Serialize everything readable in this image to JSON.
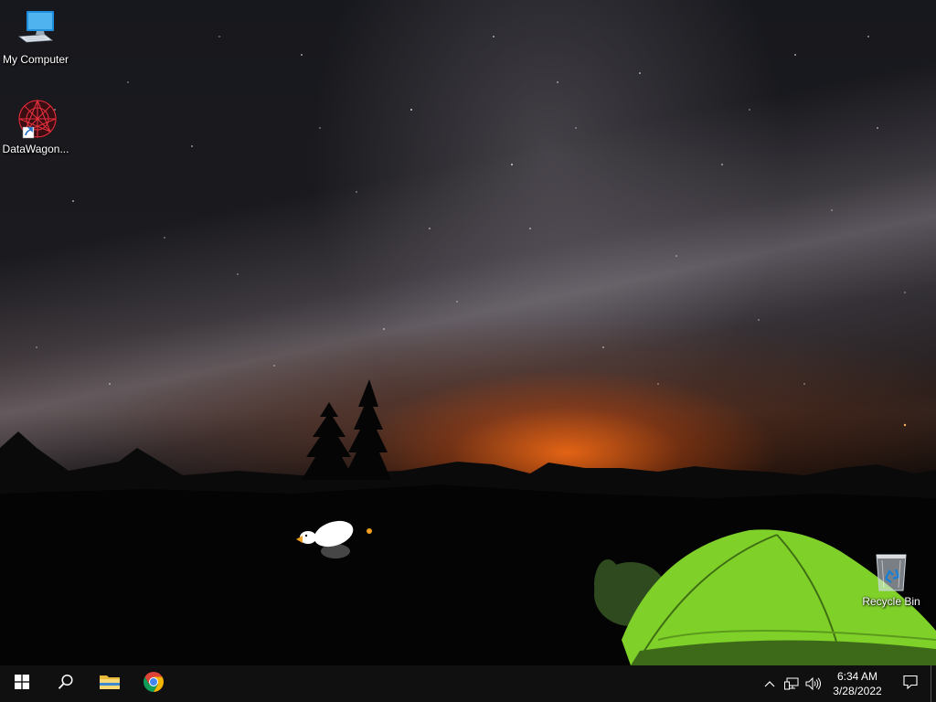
{
  "desktop": {
    "icons": [
      {
        "label": "My Computer",
        "icon": "computer-icon"
      },
      {
        "label": "DataWagon...",
        "icon": "datawagon-icon"
      },
      {
        "label": "Recycle Bin",
        "icon": "recycle-bin-icon"
      }
    ]
  },
  "taskbar": {
    "start": {
      "icon": "windows-logo-icon"
    },
    "search": {
      "icon": "search-icon"
    },
    "pinned": [
      {
        "name": "File Explorer",
        "icon": "folder-icon"
      },
      {
        "name": "Google Chrome",
        "icon": "chrome-icon"
      }
    ],
    "tray": {
      "icons": [
        "chevron-up-icon",
        "network-icon",
        "volume-icon"
      ],
      "time": "6:34 AM",
      "date": "3/28/2022",
      "notifications_icon": "notification-icon"
    }
  },
  "colors": {
    "taskbar": "#101010",
    "tent": "#7fd12a",
    "horizon_glow": "#ff6a14"
  }
}
